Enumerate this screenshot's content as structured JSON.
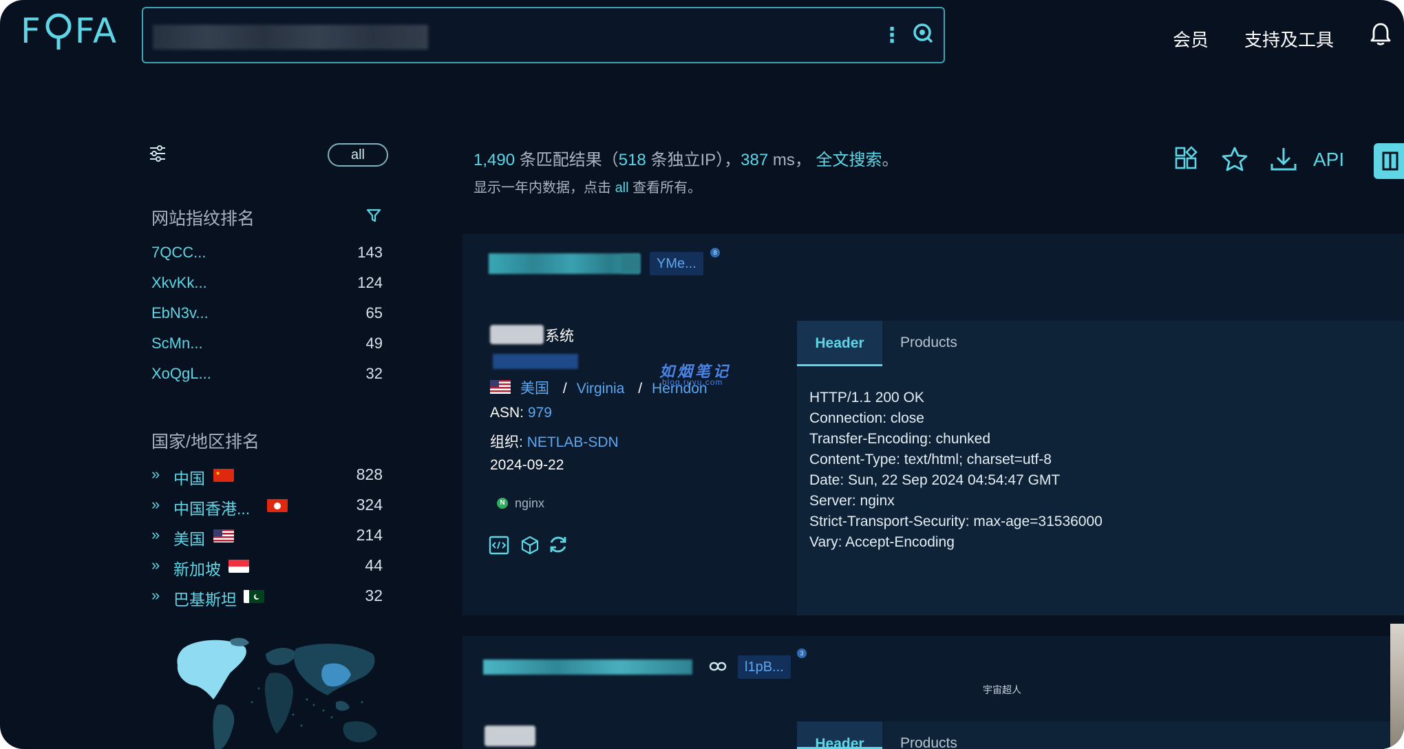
{
  "app": {
    "logo": "FOFA"
  },
  "search": {
    "query_blurred": ""
  },
  "nav": {
    "member": "会员",
    "tools": "支持及工具"
  },
  "filter": {
    "all_pill": "all"
  },
  "site_rank": {
    "title": "网站指纹排名",
    "items": [
      {
        "name": "7QCC...",
        "count": "143"
      },
      {
        "name": "XkvKk...",
        "count": "124"
      },
      {
        "name": "EbN3v...",
        "count": "65"
      },
      {
        "name": "ScMn...",
        "count": "49"
      },
      {
        "name": "XoQgL...",
        "count": "32"
      }
    ]
  },
  "country_rank": {
    "title": "国家/地区排名",
    "items": [
      {
        "name": "中国",
        "count": "828",
        "flag": "cn"
      },
      {
        "name": "中国香港...",
        "count": "324",
        "flag": "hk"
      },
      {
        "name": "美国",
        "count": "214",
        "flag": "us"
      },
      {
        "name": "新加坡",
        "count": "44",
        "flag": "sg"
      },
      {
        "name": "巴基斯坦",
        "count": "32",
        "flag": "pk"
      }
    ]
  },
  "summary": {
    "count": "1,490",
    "count_label": "条匹配结果（",
    "ips": "518",
    "ips_label": "条独立IP），",
    "ms": "387",
    "ms_label": "ms，",
    "full_search": "全文搜索",
    "end": "。",
    "note_a": "显示一年内数据，点击",
    "note_all": "all",
    "note_b": "查看所有。"
  },
  "toolbar": {
    "api": "API"
  },
  "result1": {
    "tag": "YMe...",
    "tag_badge": "8",
    "title_suffix": "系统",
    "country": "美国",
    "region": "Virginia",
    "city": "Herndon",
    "asn_label": "ASN:",
    "asn": "979",
    "org_label": "组织:",
    "org": "NETLAB-SDN",
    "date": "2024-09-22",
    "product": "nginx",
    "tabs": {
      "header": "Header",
      "products": "Products"
    },
    "header_lines": [
      "HTTP/1.1 200 OK",
      "Connection: close",
      "Transfer-Encoding: chunked",
      "Content-Type: text/html; charset=utf-8",
      "Date: Sun, 22 Sep 2024 04:54:47 GMT",
      "Server: nginx",
      "Strict-Transport-Security: max-age=31536000",
      "Vary: Accept-Encoding"
    ]
  },
  "result2": {
    "tag": "l1pB...",
    "tag_badge": "3",
    "tabs": {
      "header": "Header",
      "products": "Products"
    },
    "stamp": "宇宙超人"
  },
  "watermark": {
    "title": "如烟笔记",
    "sub": "blog.ruyu.com"
  },
  "colors": {
    "accent": "#5ed6e6",
    "link": "#5ea8f0",
    "background": "#081120",
    "panel": "#0b1a2c"
  }
}
